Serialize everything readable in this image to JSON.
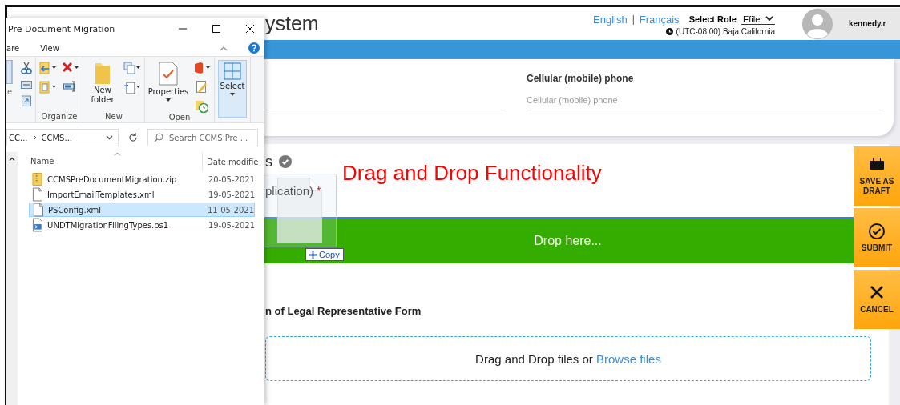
{
  "page": {
    "title": "ystem",
    "languages": [
      "English",
      "Français"
    ],
    "language_separator": "|",
    "role_label": "Select Role",
    "role": "Efiler",
    "timezone": "(UTC-08:00) Baja California",
    "user": "kennedy.r"
  },
  "contact": {
    "label": "Cellular (mobile) phone",
    "placeholder": "Cellular (mobile) phone"
  },
  "section": {
    "heading": "s",
    "verified": true,
    "subheading": "plication)",
    "required": "*"
  },
  "annotation": "Drag and Drop Functionality",
  "dropzone": {
    "text": "Drop here..."
  },
  "drag": {
    "badge": "Copy"
  },
  "form_title": "n of Legal Representative Form",
  "upload": {
    "text": "Drag and Drop files or",
    "link": "Browse files"
  },
  "actions": [
    {
      "label": "SAVE AS DRAFT",
      "kind": "save"
    },
    {
      "label": "SUBMIT",
      "kind": "submit"
    },
    {
      "label": "CANCEL",
      "kind": "cancel"
    }
  ],
  "explorer": {
    "title": "Pre Document Migration",
    "ribbon_tabs": [
      "are",
      "View"
    ],
    "clipboard_fragment": "e",
    "groups": [
      {
        "label": "Organize",
        "kind": "organize"
      },
      {
        "label": "New",
        "kind": "new",
        "button": "New folder"
      },
      {
        "label": "Open",
        "kind": "open",
        "button": "Properties"
      },
      {
        "kind": "select",
        "button": "Select"
      }
    ],
    "path": [
      "CC...",
      "CCMS..."
    ],
    "search_placeholder": "Search CCMS Pre ...",
    "columns": [
      "Name",
      "Date modifie"
    ],
    "files": [
      {
        "name": "CCMSPreDocumentMigration.zip",
        "date": "20-05-2021",
        "kind": "zip",
        "selected": false
      },
      {
        "name": "ImportEmailTemplates.xml",
        "date": "19-05-2021",
        "kind": "doc",
        "selected": false
      },
      {
        "name": "PSConfig.xml",
        "date": "11-05-2021",
        "kind": "doc",
        "selected": true
      },
      {
        "name": "UNDTMigrationFilingTypes.ps1",
        "date": "19-05-2021",
        "kind": "script",
        "selected": false
      }
    ]
  }
}
